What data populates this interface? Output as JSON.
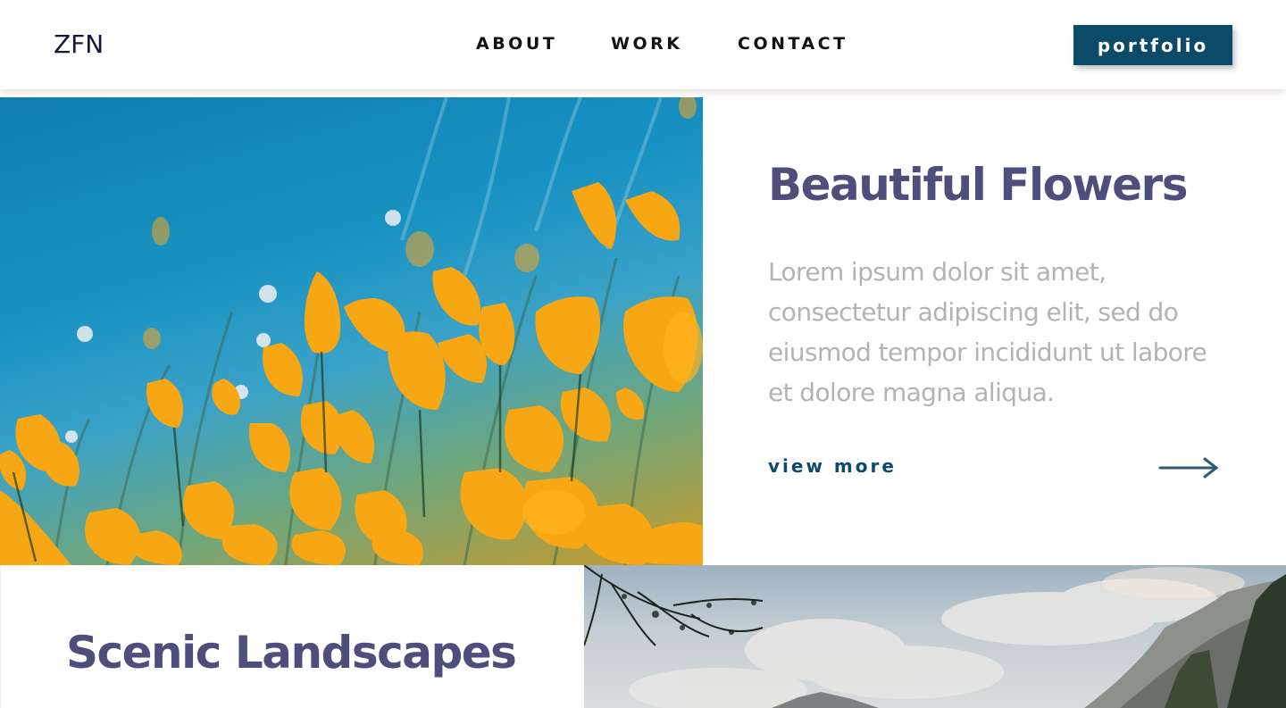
{
  "header": {
    "logo": "ZFN",
    "nav": [
      {
        "label": "ABOUT"
      },
      {
        "label": "WORK"
      },
      {
        "label": "CONTACT"
      }
    ],
    "portfolio_button": "portfolio"
  },
  "feature_flowers": {
    "title": "Beautiful Flowers",
    "description": "Lorem ipsum dolor sit amet, consectetur adipiscing elit, sed do eiusmod tempor incididunt ut labore et dolore magna aliqua.",
    "link_label": "view more",
    "image": "yellow-poppies-photo",
    "arrow_icon": "arrow-right-icon"
  },
  "feature_landscapes": {
    "title": "Scenic Landscapes",
    "image": "mountain-landscape-photo"
  },
  "colors": {
    "accent": "#0b4a68",
    "title": "#4d4e7c",
    "body_text": "#b3b3b3"
  }
}
